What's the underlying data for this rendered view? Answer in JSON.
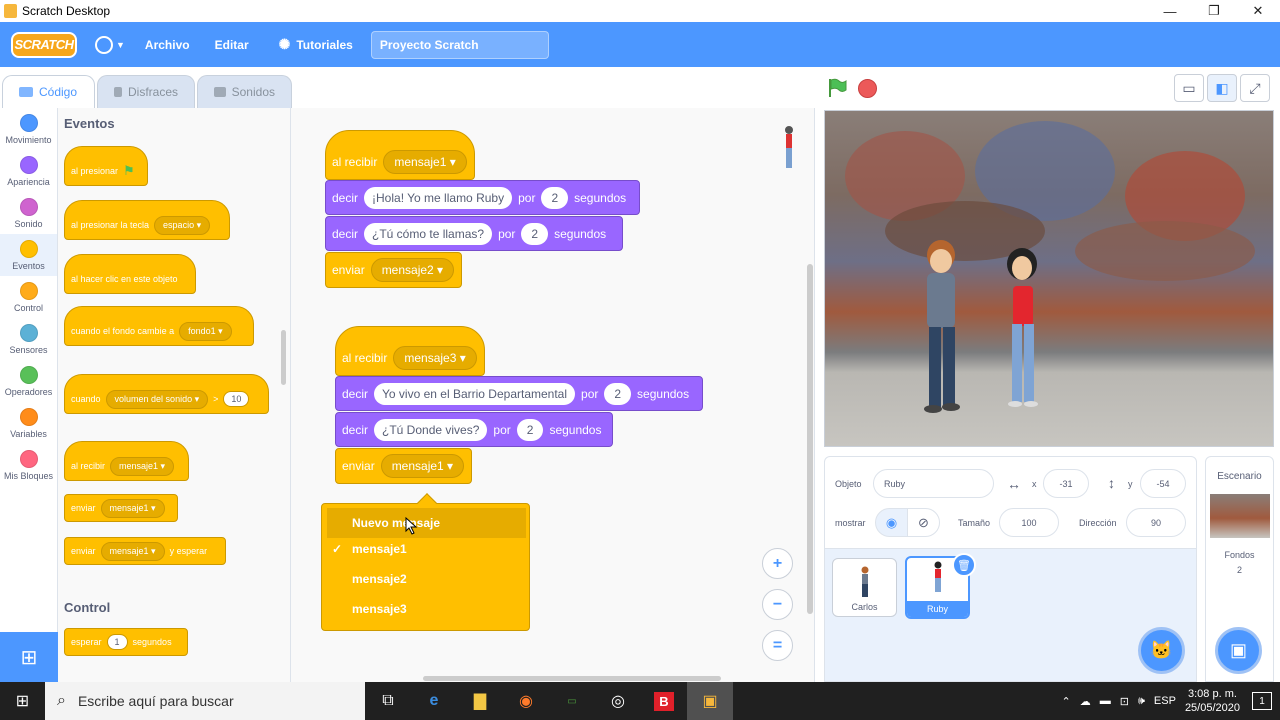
{
  "window": {
    "title": "Scratch Desktop",
    "minimize": "—",
    "maximize": "❐",
    "close": "✕"
  },
  "menubar": {
    "logo": "SCRATCH",
    "file": "Archivo",
    "edit": "Editar",
    "tutorials": "Tutoriales",
    "project_title": "Proyecto Scratch"
  },
  "tabs": [
    {
      "label": "Código",
      "active": true
    },
    {
      "label": "Disfraces",
      "active": false
    },
    {
      "label": "Sonidos",
      "active": false
    }
  ],
  "categories": [
    {
      "label": "Movimiento",
      "color": "#4c97ff"
    },
    {
      "label": "Apariencia",
      "color": "#9966ff"
    },
    {
      "label": "Sonido",
      "color": "#cf63cf"
    },
    {
      "label": "Eventos",
      "color": "#ffbf00"
    },
    {
      "label": "Control",
      "color": "#ffab19"
    },
    {
      "label": "Sensores",
      "color": "#5cb1d6"
    },
    {
      "label": "Operadores",
      "color": "#59c059"
    },
    {
      "label": "Variables",
      "color": "#ff8c1a"
    },
    {
      "label": "Mis Bloques",
      "color": "#ff6680"
    }
  ],
  "palette": {
    "events_title": "Eventos",
    "control_title": "Control",
    "when_flag": "al presionar",
    "when_key": "al presionar la tecla",
    "key_value": "espacio",
    "when_clicked": "al hacer clic en este objeto",
    "when_backdrop": "cuando el fondo cambie a",
    "backdrop_value": "fondo1",
    "when_loudness": "cuando",
    "loudness_value": "volumen del sonido",
    "loudness_op": ">",
    "loudness_num": "10",
    "when_receive": "al recibir",
    "receive_value": "mensaje1",
    "broadcast": "enviar",
    "broadcast_value": "mensaje1",
    "broadcast_wait": "enviar",
    "broadcast_wait_value": "mensaje1",
    "broadcast_wait_suffix": "y esperar",
    "wait": "esperar",
    "wait_num": "1",
    "wait_suffix": "segundos"
  },
  "scripts": {
    "script1": {
      "hat_label": "al recibir",
      "hat_value": "mensaje1",
      "say1_label": "decir",
      "say1_text": "¡Hola! Yo me llamo Ruby",
      "say1_for": "por",
      "say1_secs": "2",
      "say1_suffix": "segundos",
      "say2_label": "decir",
      "say2_text": "¿Tú  cómo te llamas?",
      "say2_for": "por",
      "say2_secs": "2",
      "say2_suffix": "segundos",
      "send_label": "enviar",
      "send_value": "mensaje2"
    },
    "script2": {
      "hat_label": "al recibir",
      "hat_value": "mensaje3",
      "say1_label": "decir",
      "say1_text": "Yo vivo en el Barrio Departamental",
      "say1_for": "por",
      "say1_secs": "2",
      "say1_suffix": "segundos",
      "say2_label": "decir",
      "say2_text": "¿Tú Donde vives?",
      "say2_for": "por",
      "say2_secs": "2",
      "say2_suffix": "segundos",
      "send_label": "enviar",
      "send_value": "mensaje1"
    }
  },
  "dropdown": {
    "items": [
      "Nuevo mensaje",
      "mensaje1",
      "mensaje2",
      "mensaje3"
    ],
    "checked": "mensaje1",
    "checkmark": "✓"
  },
  "zoom": {
    "in": "+",
    "out": "−",
    "reset": "="
  },
  "sprite_info": {
    "object_label": "Objeto",
    "object_name": "Ruby",
    "x_label": "x",
    "x_value": "-31",
    "y_label": "y",
    "y_value": "-54",
    "show_label": "mostrar",
    "size_label": "Tamaño",
    "size_value": "100",
    "direction_label": "Dirección",
    "direction_value": "90"
  },
  "sprites": [
    {
      "name": "Carlos",
      "selected": false
    },
    {
      "name": "Ruby",
      "selected": true
    }
  ],
  "stage_pane": {
    "title": "Escenario",
    "backdrops_label": "Fondos",
    "backdrops_count": "2"
  },
  "taskbar": {
    "search_placeholder": "Escribe aquí para buscar",
    "lang": "ESP",
    "time": "3:08 p. m.",
    "date": "25/05/2020",
    "notif_count": "1"
  }
}
